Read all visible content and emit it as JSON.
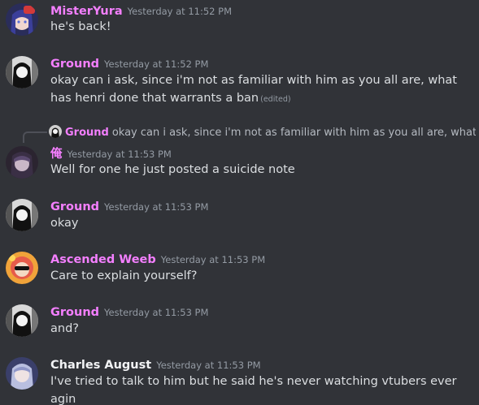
{
  "colors": {
    "background": "#313338",
    "username_pink": "#f47fff",
    "username_white": "#f2f3f5",
    "timestamp": "#949ba4",
    "message_text": "#dbdee1"
  },
  "messages": [
    {
      "author": "MisterYura",
      "timestamp": "Yesterday at 11:52 PM",
      "text": "he's back!"
    },
    {
      "author": "Ground",
      "timestamp": "Yesterday at 11:52 PM",
      "text": "okay can i ask, since i'm not as familiar with him as you all are, what has henri done that warrants a ban",
      "edited_label": "(edited)"
    },
    {
      "reply": {
        "author": "Ground",
        "preview": "okay can i ask, since i'm not as familiar with him as you all are, what has h..."
      },
      "author": "俺",
      "timestamp": "Yesterday at 11:53 PM",
      "text": "Well for one he just posted a suicide note"
    },
    {
      "author": "Ground",
      "timestamp": "Yesterday at 11:53 PM",
      "text": "okay"
    },
    {
      "author": "Ascended Weeb",
      "timestamp": "Yesterday at 11:53 PM",
      "text": "Care to explain yourself?"
    },
    {
      "author": "Ground",
      "timestamp": "Yesterday at 11:53 PM",
      "text": "and?"
    },
    {
      "author": "Charles August",
      "timestamp": "Yesterday at 11:53 PM",
      "text": "I've tried to talk to him but he said he's never watching vtubers ever agin"
    }
  ]
}
